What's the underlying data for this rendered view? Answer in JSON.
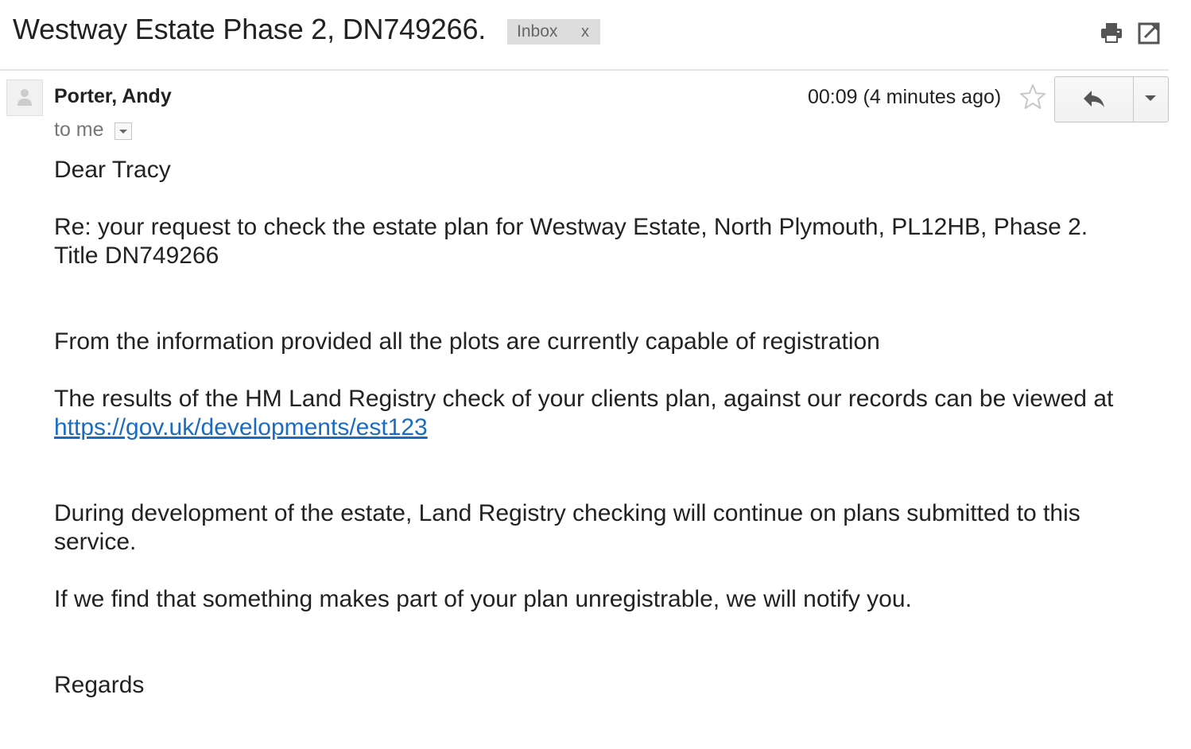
{
  "header": {
    "subject": "Westway Estate Phase 2, DN749266.",
    "label": "Inbox",
    "label_remove": "x"
  },
  "message": {
    "sender": "Porter, Andy",
    "recipient": "to me",
    "timestamp": "00:09 (4 minutes ago)",
    "body": {
      "greeting": "Dear Tracy",
      "re_line": "Re: your request to check the estate plan for Westway Estate, North Plymouth, PL12HB, Phase 2.  Title DN749266",
      "info": "From the information provided all the plots are currently capable of registration",
      "results_prefix": "The results of the HM Land Registry check of your clients plan, against our records can be viewed at ",
      "results_link": "https://gov.uk/developments/est123",
      "during": "During development of the estate, Land Registry checking will continue on plans submitted to this service.",
      "notify": "If we find that something makes part of your plan unregistrable, we will notify you.",
      "regards": "Regards"
    }
  },
  "icons": {
    "print": "print-icon",
    "popout": "popout-icon",
    "star": "star-icon",
    "reply": "reply-icon",
    "avatar": "person-icon"
  },
  "colors": {
    "link": "#1a6cc2",
    "label_bg": "#dddddd",
    "muted_text": "#777777"
  }
}
